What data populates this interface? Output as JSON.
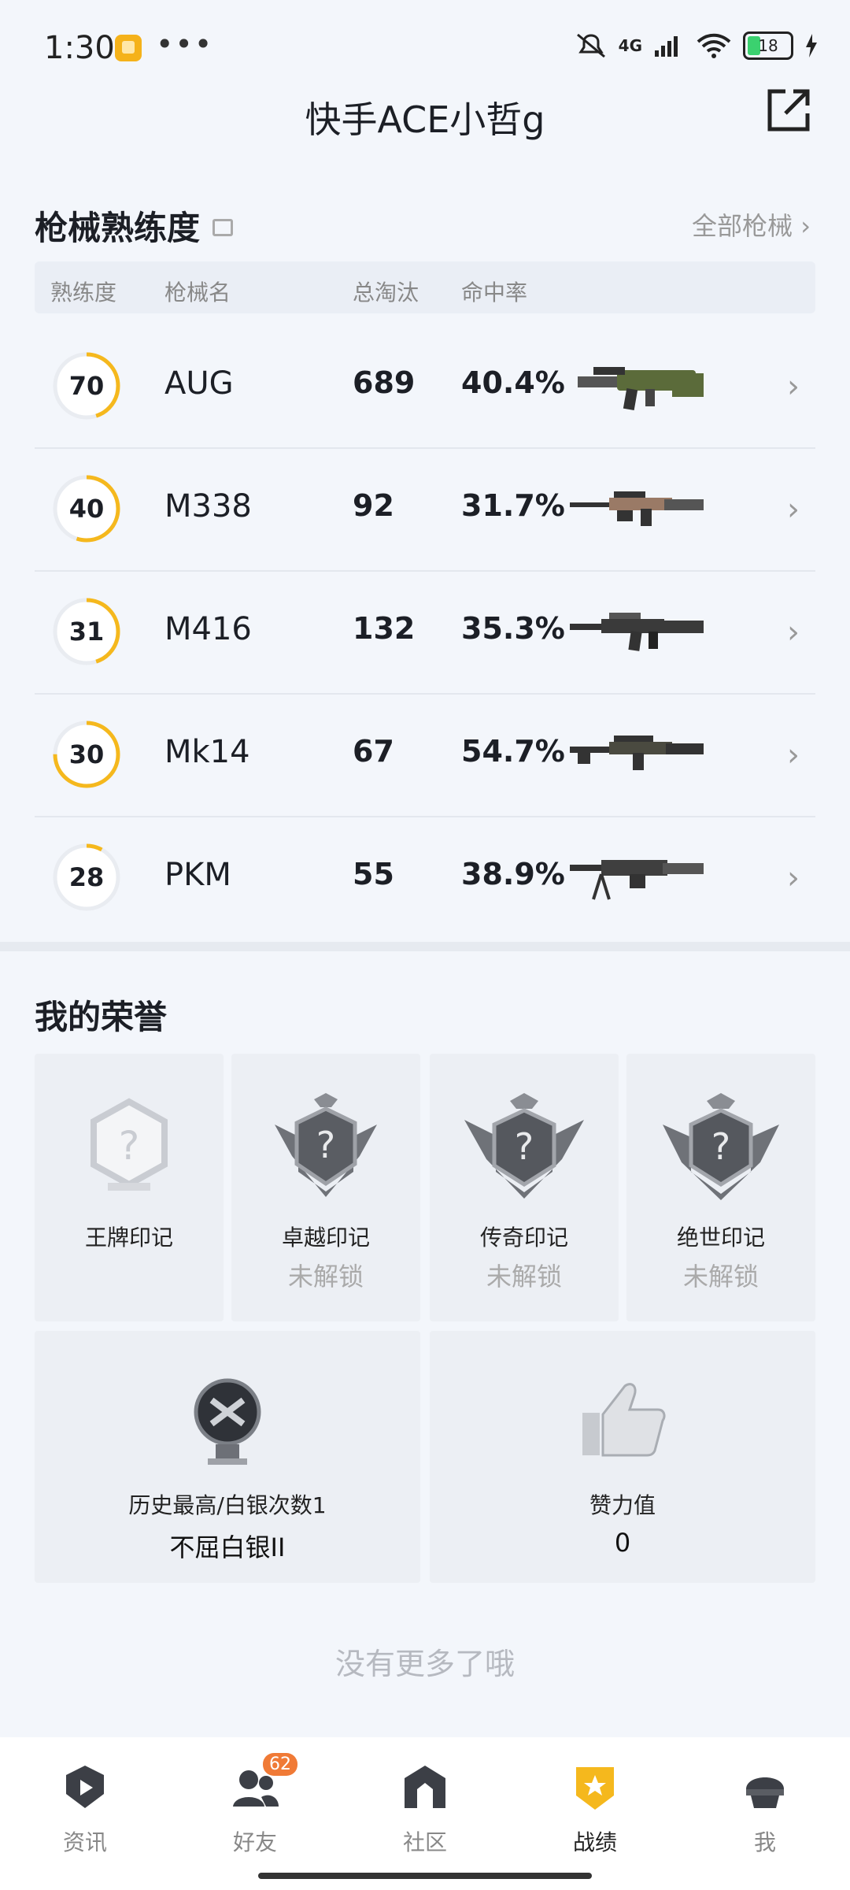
{
  "status": {
    "time": "1:30",
    "network": "4G",
    "battery": "18"
  },
  "header": {
    "title": "快手ACE小哲g"
  },
  "weapons": {
    "section_title": "枪械熟练度",
    "all_link": "全部枪械",
    "columns": [
      "熟练度",
      "枪械名",
      "总淘汰",
      "命中率"
    ],
    "rows": [
      {
        "mastery": "70",
        "progress": 0.45,
        "name": "AUG",
        "kills": "689",
        "accuracy": "40.4%"
      },
      {
        "mastery": "40",
        "progress": 0.55,
        "name": "M338",
        "kills": "92",
        "accuracy": "31.7%"
      },
      {
        "mastery": "31",
        "progress": 0.45,
        "name": "M416",
        "kills": "132",
        "accuracy": "35.3%"
      },
      {
        "mastery": "30",
        "progress": 0.75,
        "name": "Mk14",
        "kills": "67",
        "accuracy": "54.7%"
      },
      {
        "mastery": "28",
        "progress": 0.08,
        "name": "PKM",
        "kills": "55",
        "accuracy": "38.9%"
      }
    ]
  },
  "honors": {
    "section_title": "我的荣誉",
    "badges": [
      {
        "label": "王牌印记",
        "status": ""
      },
      {
        "label": "卓越印记",
        "status": "未解锁"
      },
      {
        "label": "传奇印记",
        "status": "未解锁"
      },
      {
        "label": "绝世印记",
        "status": "未解锁"
      }
    ],
    "rank": {
      "label": "历史最高/白银次数1",
      "value": "不屈白银II"
    },
    "likes": {
      "label": "赞力值",
      "value": "0"
    }
  },
  "footer_note": "没有更多了哦",
  "tabs": [
    {
      "label": "资讯",
      "icon": "news-icon",
      "active": false
    },
    {
      "label": "好友",
      "icon": "friends-icon",
      "active": false,
      "badge": "62"
    },
    {
      "label": "社区",
      "icon": "community-icon",
      "active": false
    },
    {
      "label": "战绩",
      "icon": "record-icon",
      "active": true
    },
    {
      "label": "我",
      "icon": "profile-icon",
      "active": false
    }
  ],
  "colors": {
    "accent": "#f5b81d",
    "text": "#1c1f26",
    "muted": "#999999"
  }
}
